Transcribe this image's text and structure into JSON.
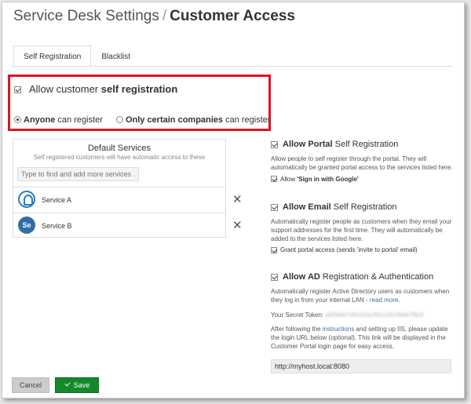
{
  "header": {
    "section": "Service Desk Settings",
    "separator": "/",
    "page": "Customer Access"
  },
  "tabs": [
    {
      "label": "Self Registration",
      "active": true
    },
    {
      "label": "Blacklist",
      "active": false
    }
  ],
  "self_registration": {
    "allow_prefix": "Allow customer ",
    "allow_strong": "self registration",
    "checked": true,
    "options": [
      {
        "strong": "Anyone",
        "rest": " can register",
        "selected": true
      },
      {
        "strong": "Only certain companies",
        "rest": " can register",
        "selected": false
      }
    ]
  },
  "default_services": {
    "title": "Default Services",
    "subtitle": "Self registered customers will have automatic access to these",
    "search_placeholder": "Type to find and add more services ...",
    "items": [
      {
        "name": "Service A",
        "avatar_icon": "service-a-logo-icon"
      },
      {
        "name": "Service B",
        "avatar_text": "Se"
      }
    ],
    "remove_glyph": "✕"
  },
  "portal": {
    "strong": "Allow Portal",
    "rest": " Self Registration",
    "checked": true,
    "desc": "Allow people to self register through the portal. They will automatically be granted portal access to the services listed here.",
    "sub_prefix": "Allow ",
    "sub_strong": "'Sign in with Google'",
    "sub_checked": true
  },
  "email": {
    "strong": "Allow Email",
    "rest": " Self Registration",
    "checked": true,
    "desc": "Automatically register people as customers when they email your support addresses for the first time. They will automatically be added to the services listed here.",
    "sub": "Grant portal access (sends 'invite to portal' email)",
    "sub_checked": true
  },
  "ad": {
    "strong": "Allow AD",
    "rest": " Registration & Authentication",
    "checked": true,
    "desc": "Automatically register Active Directory users as customers when they log in from your internal LAN - ",
    "read_more": "read more.",
    "token_label": "Your Secret Token:",
    "token_value": "a9f3b8e7d6c5b4a3f2e1d0c9b8a7f6e5",
    "follow_prefix": "After following the ",
    "follow_link": "instructions",
    "follow_rest": " and setting up IIS, please update the login URL below (optional). This link will be displayed in the Customer Portal login page for easy access.",
    "url_value": "http://myhost.local:8080"
  },
  "buttons": {
    "cancel": "Cancel",
    "save": "Save"
  },
  "colors": {
    "highlight": "#e0141e",
    "save": "#14892c",
    "link": "#3572b0"
  }
}
